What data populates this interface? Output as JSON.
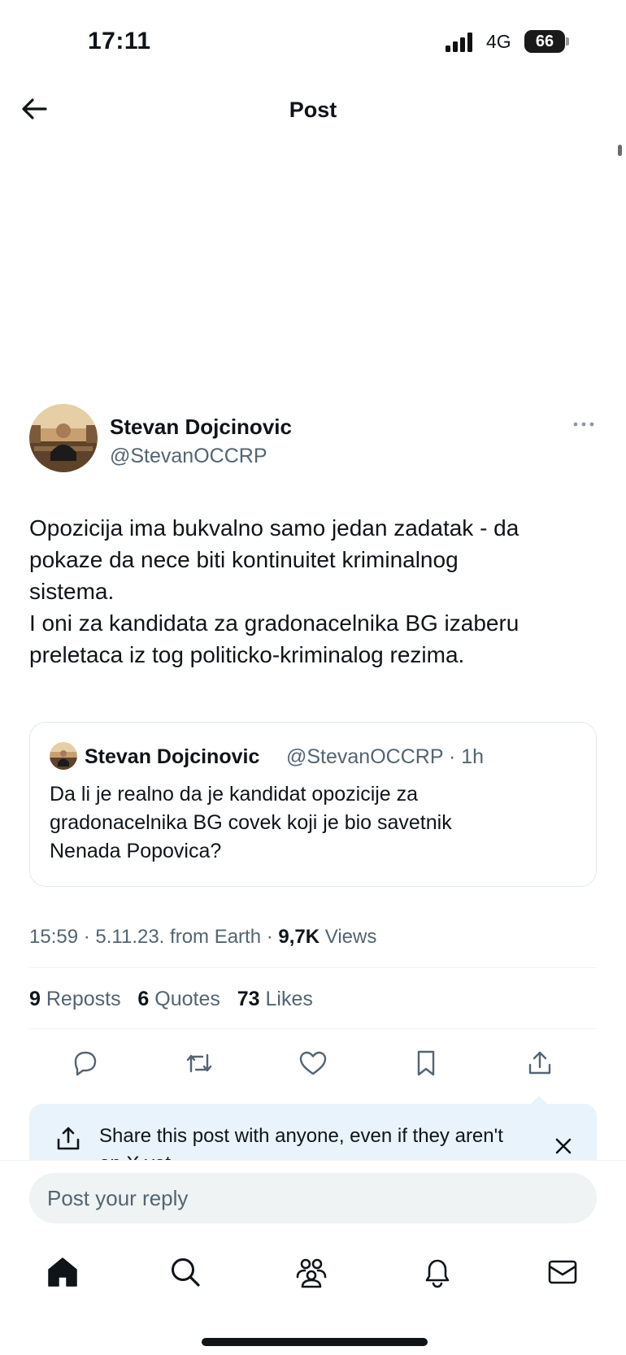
{
  "status_bar": {
    "time": "17:11",
    "network": "4G",
    "battery": "66"
  },
  "header": {
    "title": "Post"
  },
  "post": {
    "author_name": "Stevan Dojcinovic",
    "author_handle": "@StevanOCCRP",
    "text_lines": [
      "Opozicija ima bukvalno samo jedan zadatak - da",
      "pokaze da nece biti kontinuitet kriminalnog",
      "sistema.",
      "I oni za kandidata za gradonacelnika BG izaberu",
      "preletaca iz tog politicko-kriminalog rezima."
    ],
    "quote": {
      "author_name": "Stevan Dojcinovic",
      "author_meta": "@StevanOCCRP · 1h",
      "text_lines": [
        "Da li je realno da je kandidat opozicije za",
        "gradonacelnika BG covek koji je bio savetnik",
        "Nenada Popovica?"
      ]
    },
    "meta": {
      "time": "15:59",
      "date": "5.11.23.",
      "source": "from Earth",
      "views_count": "9,7K",
      "views_label": "Views"
    },
    "stats": {
      "reposts_count": "9",
      "reposts_label": "Reposts",
      "quotes_count": "6",
      "quotes_label": "Quotes",
      "likes_count": "73",
      "likes_label": "Likes"
    }
  },
  "share_banner": {
    "text": "Share this post with anyone, even if they aren't on X yet"
  },
  "reply": {
    "placeholder": "Post your reply"
  },
  "icons": {
    "actions": [
      "reply-icon",
      "repost-icon",
      "like-icon",
      "bookmark-icon",
      "share-icon"
    ],
    "nav": [
      "home-icon",
      "search-icon",
      "communities-icon",
      "notifications-icon",
      "messages-icon"
    ]
  },
  "colors": {
    "text": "#0f1419",
    "secondary": "#536471",
    "banner": "#e8f3fb",
    "divider": "#eff3f4"
  }
}
